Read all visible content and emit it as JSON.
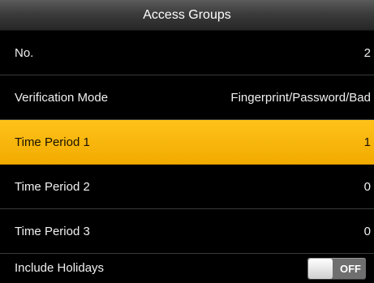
{
  "header": {
    "title": "Access Groups"
  },
  "rows": [
    {
      "label": "No.",
      "value": "2"
    },
    {
      "label": "Verification Mode",
      "value": "Fingerprint/Password/Bad"
    },
    {
      "label": "Time Period 1",
      "value": "1"
    },
    {
      "label": "Time Period 2",
      "value": "0"
    },
    {
      "label": "Time Period 3",
      "value": "0"
    },
    {
      "label": "Include Holidays",
      "toggle_text": "OFF"
    }
  ],
  "selected_row": "Time Period 1",
  "colors": {
    "highlight": "#f7b500",
    "background": "#000000"
  }
}
